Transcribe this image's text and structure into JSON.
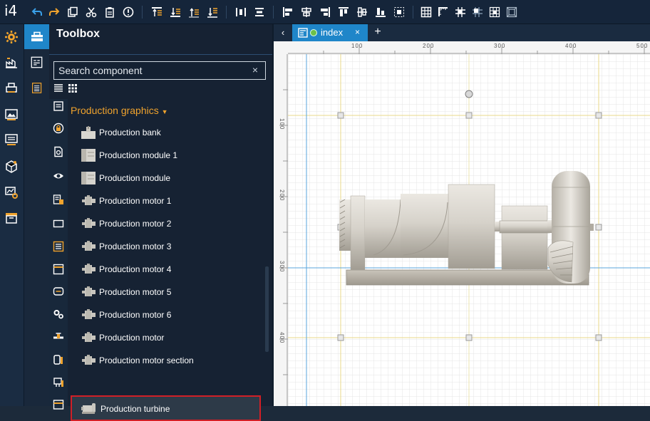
{
  "app": {
    "logo": "i4"
  },
  "toolbox": {
    "title": "Toolbox",
    "search_placeholder": "Search component",
    "search_clear": "×",
    "group": "Production graphics",
    "items": [
      {
        "label": "Production bank",
        "icon": "bank-icon"
      },
      {
        "label": "Production module 1",
        "icon": "module-icon"
      },
      {
        "label": "Production module",
        "icon": "module-icon"
      },
      {
        "label": "Production motor 1",
        "icon": "motor-icon"
      },
      {
        "label": "Production motor 2",
        "icon": "motor-icon"
      },
      {
        "label": "Production motor 3",
        "icon": "motor-icon"
      },
      {
        "label": "Production motor 4",
        "icon": "motor-icon"
      },
      {
        "label": "Production motor 5",
        "icon": "motor-icon"
      },
      {
        "label": "Production motor 6",
        "icon": "motor-icon"
      },
      {
        "label": "Production motor",
        "icon": "motor-icon"
      },
      {
        "label": "Production motor section",
        "icon": "motor-icon"
      },
      {
        "label": "Production turbine",
        "icon": "turbine-icon"
      }
    ],
    "selected_index": 11
  },
  "tabs": {
    "back": "‹",
    "active": {
      "name": "index",
      "close": "×"
    },
    "add": "+"
  },
  "ruler": {
    "top": [
      "100",
      "200",
      "300",
      "400",
      "500"
    ],
    "left": [
      "100",
      "200",
      "300",
      "400"
    ]
  },
  "colors": {
    "accent": "#1f86c9",
    "group": "#f0a32d",
    "selection": "#d21f26",
    "toolbar_bg": "#15253a",
    "guide_yellow": "#e8d98a",
    "guide_blue": "#5aa5dc"
  }
}
